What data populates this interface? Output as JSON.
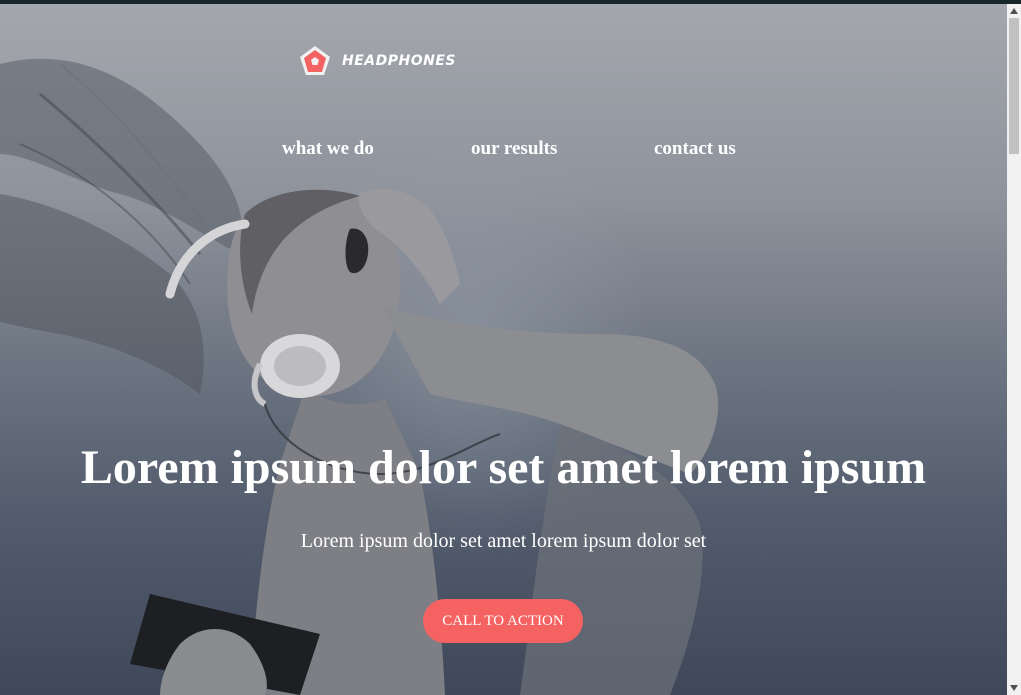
{
  "brand": {
    "name": "HEADPHONES",
    "accent_color": "#f56262"
  },
  "nav": {
    "items": [
      {
        "label": "what we do"
      },
      {
        "label": "our results"
      },
      {
        "label": "contact us"
      }
    ]
  },
  "hero": {
    "headline": "Lorem ipsum dolor set amet lorem ipsum",
    "subheadline": "Lorem ipsum dolor set amet lorem ipsum dolor set",
    "cta_label": "CALL TO ACTION",
    "background_image": "photo-woman-with-headphones"
  },
  "icons": {
    "logo": "pentagon-logo-icon",
    "scroll_up": "arrow-up-icon",
    "scroll_down": "arrow-down-icon"
  }
}
